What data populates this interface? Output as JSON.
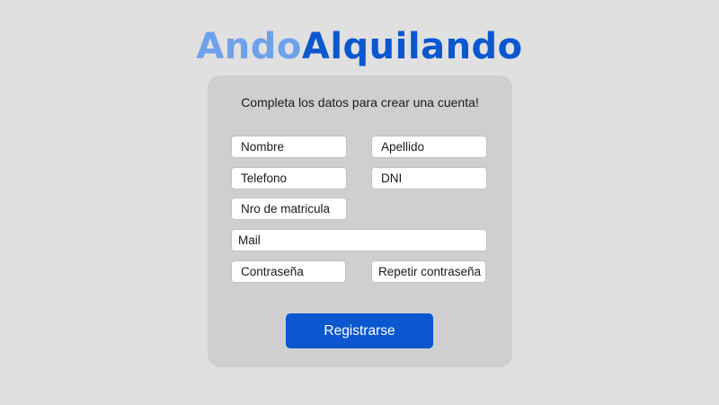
{
  "brand": {
    "name_part1": "Ando",
    "name_part2": "Alquilando",
    "color_light": "#6fa1ea",
    "color_dark": "#0b57d0"
  },
  "form": {
    "subtitle": "Completa los datos para crear una cuenta!",
    "fields": {
      "nombre": "Nombre",
      "apellido": "Apellido",
      "telefono": "Telefono",
      "dni": "DNI",
      "matricula": "Nro de matricula",
      "mail": "Mail",
      "password": "Contraseña",
      "password_repeat": "Repetir contraseña"
    },
    "submit_label": "Registrarse"
  }
}
